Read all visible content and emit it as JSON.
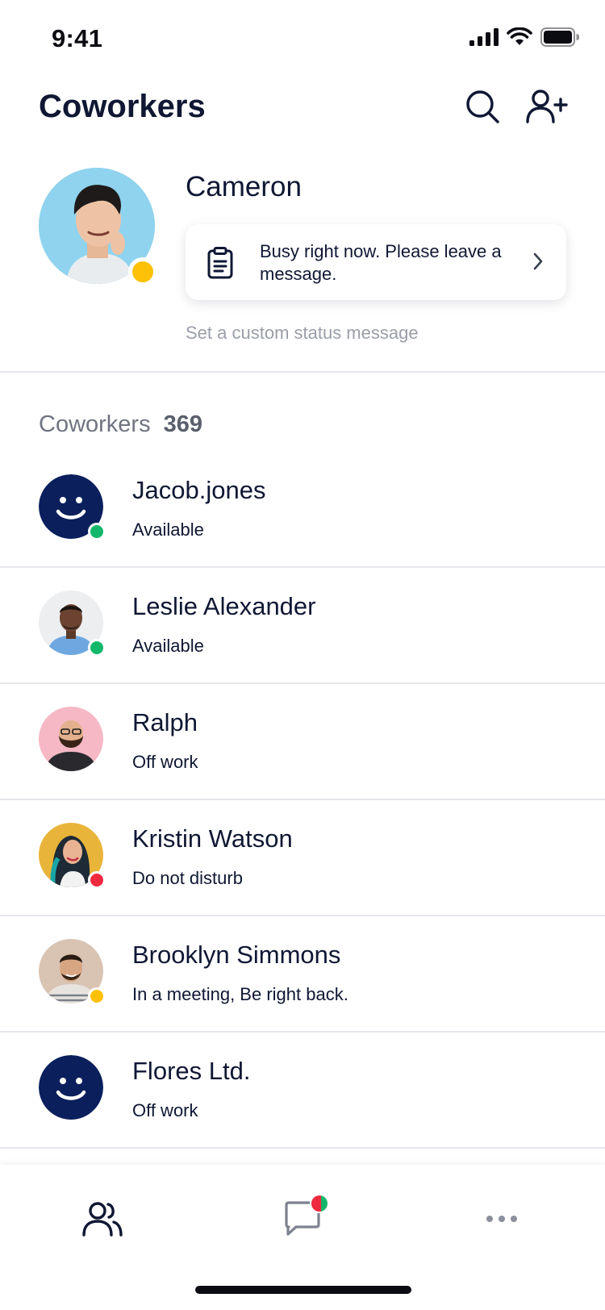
{
  "status_bar": {
    "time": "9:41"
  },
  "header": {
    "title": "Coworkers"
  },
  "profile": {
    "name": "Cameron",
    "status_message": "Busy right now. Please leave a message.",
    "custom_status_link": "Set a custom status message",
    "presence_color": "#ffc107"
  },
  "coworkers": {
    "label": "Coworkers",
    "count": "369",
    "items": [
      {
        "name": "Jacob.jones",
        "status": "Available",
        "presence": "available",
        "avatar": "smiley-placeholder"
      },
      {
        "name": "Leslie Alexander",
        "status": "Available",
        "presence": "available",
        "avatar": "photo"
      },
      {
        "name": "Ralph",
        "status": "Off work",
        "presence": "none",
        "avatar": "photo"
      },
      {
        "name": "Kristin Watson",
        "status": "Do not disturb",
        "presence": "dnd",
        "avatar": "photo"
      },
      {
        "name": "Brooklyn Simmons",
        "status": "In a meeting, Be right back.",
        "presence": "away",
        "avatar": "photo"
      },
      {
        "name": "Flores Ltd.",
        "status": "Off work",
        "presence": "none",
        "avatar": "smiley-placeholder"
      }
    ]
  },
  "colors": {
    "navy": "#0a1f5c",
    "available": "#12b76a",
    "away": "#ffc107",
    "dnd": "#ef2a3f",
    "text": "#0f1733",
    "muted": "#9a9ea8"
  },
  "nav": {
    "items": [
      {
        "name": "people",
        "icon": "people-icon"
      },
      {
        "name": "chat",
        "icon": "chat-icon",
        "badge": true
      },
      {
        "name": "more",
        "icon": "more-icon"
      }
    ]
  }
}
